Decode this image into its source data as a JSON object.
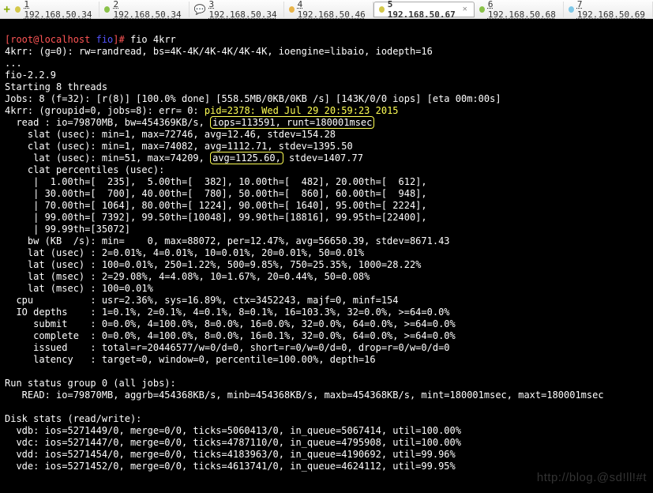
{
  "tabs": {
    "items": [
      {
        "index": "1",
        "ip": "192.168.50.34",
        "color": "#d4c84a"
      },
      {
        "index": "2",
        "ip": "192.168.50.34",
        "color": "#8ac24a"
      },
      {
        "index": "3",
        "ip": "192.168.50.34",
        "color": "#7fc8e8",
        "icon": "chat"
      },
      {
        "index": "4",
        "ip": "192.168.50.46",
        "color": "#e8b44a"
      },
      {
        "index": "5",
        "ip": "192.168.50.67",
        "color": "#d4c84a",
        "active": true
      },
      {
        "index": "6",
        "ip": "192.168.50.68",
        "color": "#8ac24a"
      },
      {
        "index": "7",
        "ip": "192.168.50.69",
        "color": "#7fc8e8"
      }
    ]
  },
  "prompt": {
    "user_host": "[root@localhost ",
    "dir": "fio",
    "suffix": "]# ",
    "cmd": "fio 4krr"
  },
  "lines": {
    "l1": "4krr: (g=0): rw=randread, bs=4K-4K/4K-4K/4K-4K, ioengine=libaio, iodepth=16",
    "l2": "...",
    "l3": "fio-2.2.9",
    "l4": "Starting 8 threads",
    "l5": "Jobs: 8 (f=32): [r(8)] [100.0% done] [558.5MB/0KB/0KB /s] [143K/0/0 iops] [eta 00m:00s]",
    "l6a": "4krr: (groupid=0, jobs=8): err= 0: ",
    "l6b": "pid=2378: Wed Jul 29 20:59:23 2015",
    "l7a": "  read : io=79870MB, bw=454369KB/s, ",
    "l7b": "iops=113591, runt=180001msec",
    "l8": "    slat (usec): min=1, max=72746, avg=12.46, stdev=154.28",
    "l9": "    clat (usec): min=1, max=74082, avg=1112.71, stdev=1395.50",
    "l10a": "     lat (usec): min=51, max=74209, ",
    "l10b": "avg=1125.60,",
    "l10c": " stdev=1407.77",
    "l11": "    clat percentiles (usec):",
    "l12": "     |  1.00th=[  235],  5.00th=[  382], 10.00th=[  482], 20.00th=[  612],",
    "l13": "     | 30.00th=[  700], 40.00th=[  780], 50.00th=[  860], 60.00th=[  948],",
    "l14": "     | 70.00th=[ 1064], 80.00th=[ 1224], 90.00th=[ 1640], 95.00th=[ 2224],",
    "l15": "     | 99.00th=[ 7392], 99.50th=[10048], 99.90th=[18816], 99.95th=[22400],",
    "l16": "     | 99.99th=[35072]",
    "l17": "    bw (KB  /s): min=    0, max=88072, per=12.47%, avg=56650.39, stdev=8671.43",
    "l18": "    lat (usec) : 2=0.01%, 4=0.01%, 10=0.01%, 20=0.01%, 50=0.01%",
    "l19": "    lat (usec) : 100=0.01%, 250=1.22%, 500=9.85%, 750=25.35%, 1000=28.22%",
    "l20": "    lat (msec) : 2=29.08%, 4=4.08%, 10=1.67%, 20=0.44%, 50=0.08%",
    "l21": "    lat (msec) : 100=0.01%",
    "l22": "  cpu          : usr=2.36%, sys=16.89%, ctx=3452243, majf=0, minf=154",
    "l23": "  IO depths    : 1=0.1%, 2=0.1%, 4=0.1%, 8=0.1%, 16=103.3%, 32=0.0%, >=64=0.0%",
    "l24": "     submit    : 0=0.0%, 4=100.0%, 8=0.0%, 16=0.0%, 32=0.0%, 64=0.0%, >=64=0.0%",
    "l25": "     complete  : 0=0.0%, 4=100.0%, 8=0.0%, 16=0.1%, 32=0.0%, 64=0.0%, >=64=0.0%",
    "l26": "     issued    : total=r=20446577/w=0/d=0, short=r=0/w=0/d=0, drop=r=0/w=0/d=0",
    "l27": "     latency   : target=0, window=0, percentile=100.00%, depth=16",
    "l28": "",
    "l29": "Run status group 0 (all jobs):",
    "l30": "   READ: io=79870MB, aggrb=454368KB/s, minb=454368KB/s, maxb=454368KB/s, mint=180001msec, maxt=180001msec",
    "l31": "",
    "l32": "Disk stats (read/write):",
    "l33": "  vdb: ios=5271449/0, merge=0/0, ticks=5060413/0, in_queue=5067414, util=100.00%",
    "l34": "  vdc: ios=5271447/0, merge=0/0, ticks=4787110/0, in_queue=4795908, util=100.00%",
    "l35": "  vdd: ios=5271454/0, merge=0/0, ticks=4183963/0, in_queue=4190692, util=99.96%",
    "l36": "  vde: ios=5271452/0, merge=0/0, ticks=4613741/0, in_queue=4624112, util=99.95%"
  },
  "watermark": "http://blog.@sd!ll!#t"
}
